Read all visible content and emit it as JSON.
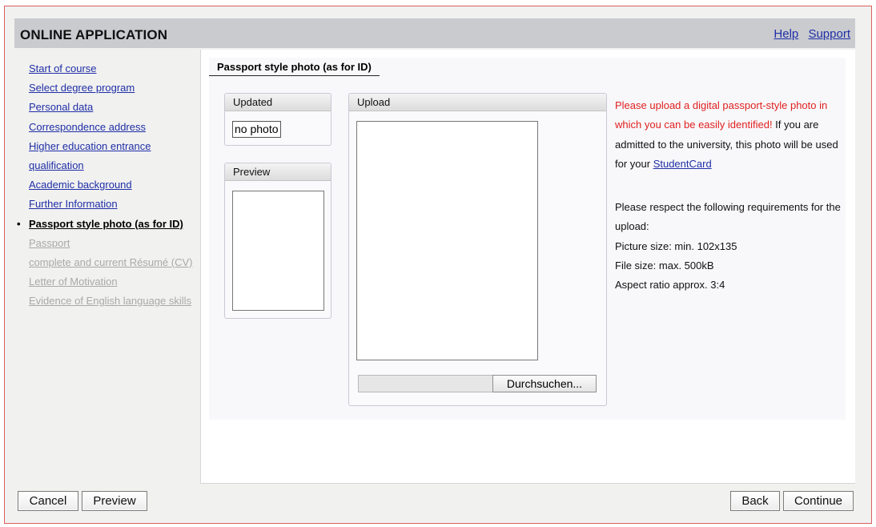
{
  "header": {
    "title": "Online Application",
    "title_display": "ONLINE APPLICATION",
    "links": [
      "Help",
      "Support"
    ]
  },
  "sidebar": {
    "items": [
      {
        "label": "Start of course",
        "state": "link"
      },
      {
        "label": "Select degree program",
        "state": "link"
      },
      {
        "label": "Personal data",
        "state": "link"
      },
      {
        "label": "Correspondence address",
        "state": "link"
      },
      {
        "label": "Higher education entrance",
        "state": "link"
      },
      {
        "label": "qualification",
        "state": "link"
      },
      {
        "label": "Academic background",
        "state": "link"
      },
      {
        "label": "Further Information",
        "state": "link"
      },
      {
        "label": "Passport style photo (as for ID)",
        "state": "active"
      },
      {
        "label": "Passport",
        "state": "disabled"
      },
      {
        "label": "complete and current Résumé (CV)",
        "state": "disabled"
      },
      {
        "label": "Letter of Motivation",
        "state": "disabled"
      },
      {
        "label": "Evidence of English language skills",
        "state": "disabled"
      }
    ],
    "bullet": "•"
  },
  "main": {
    "section_title": "Passport style photo (as for ID)",
    "updated": {
      "heading": "Updated",
      "value": "no photo"
    },
    "preview": {
      "heading": "Preview"
    },
    "upload": {
      "heading": "Upload",
      "browse_label": "Durchsuchen..."
    },
    "info": {
      "red_text": "Please upload a digital passport-style photo in which you can be easily identified!",
      "text_after": " If you are admitted to the university, this photo will be used for your ",
      "link": "StudentCard",
      "requirements_intro": "Please respect the following requirements for the upload:",
      "requirements": [
        "Picture size: min. 102x135",
        "File size: max. 500kB",
        "Aspect ratio approx. 3:4"
      ]
    }
  },
  "footer": {
    "cancel": "Cancel",
    "preview": "Preview",
    "back": "Back",
    "continue": "Continue"
  },
  "colors": {
    "link": "#1f2fa6",
    "warning": "#e02020",
    "header_bg": "#c9cbcf",
    "frame_border": "#d9605f"
  }
}
